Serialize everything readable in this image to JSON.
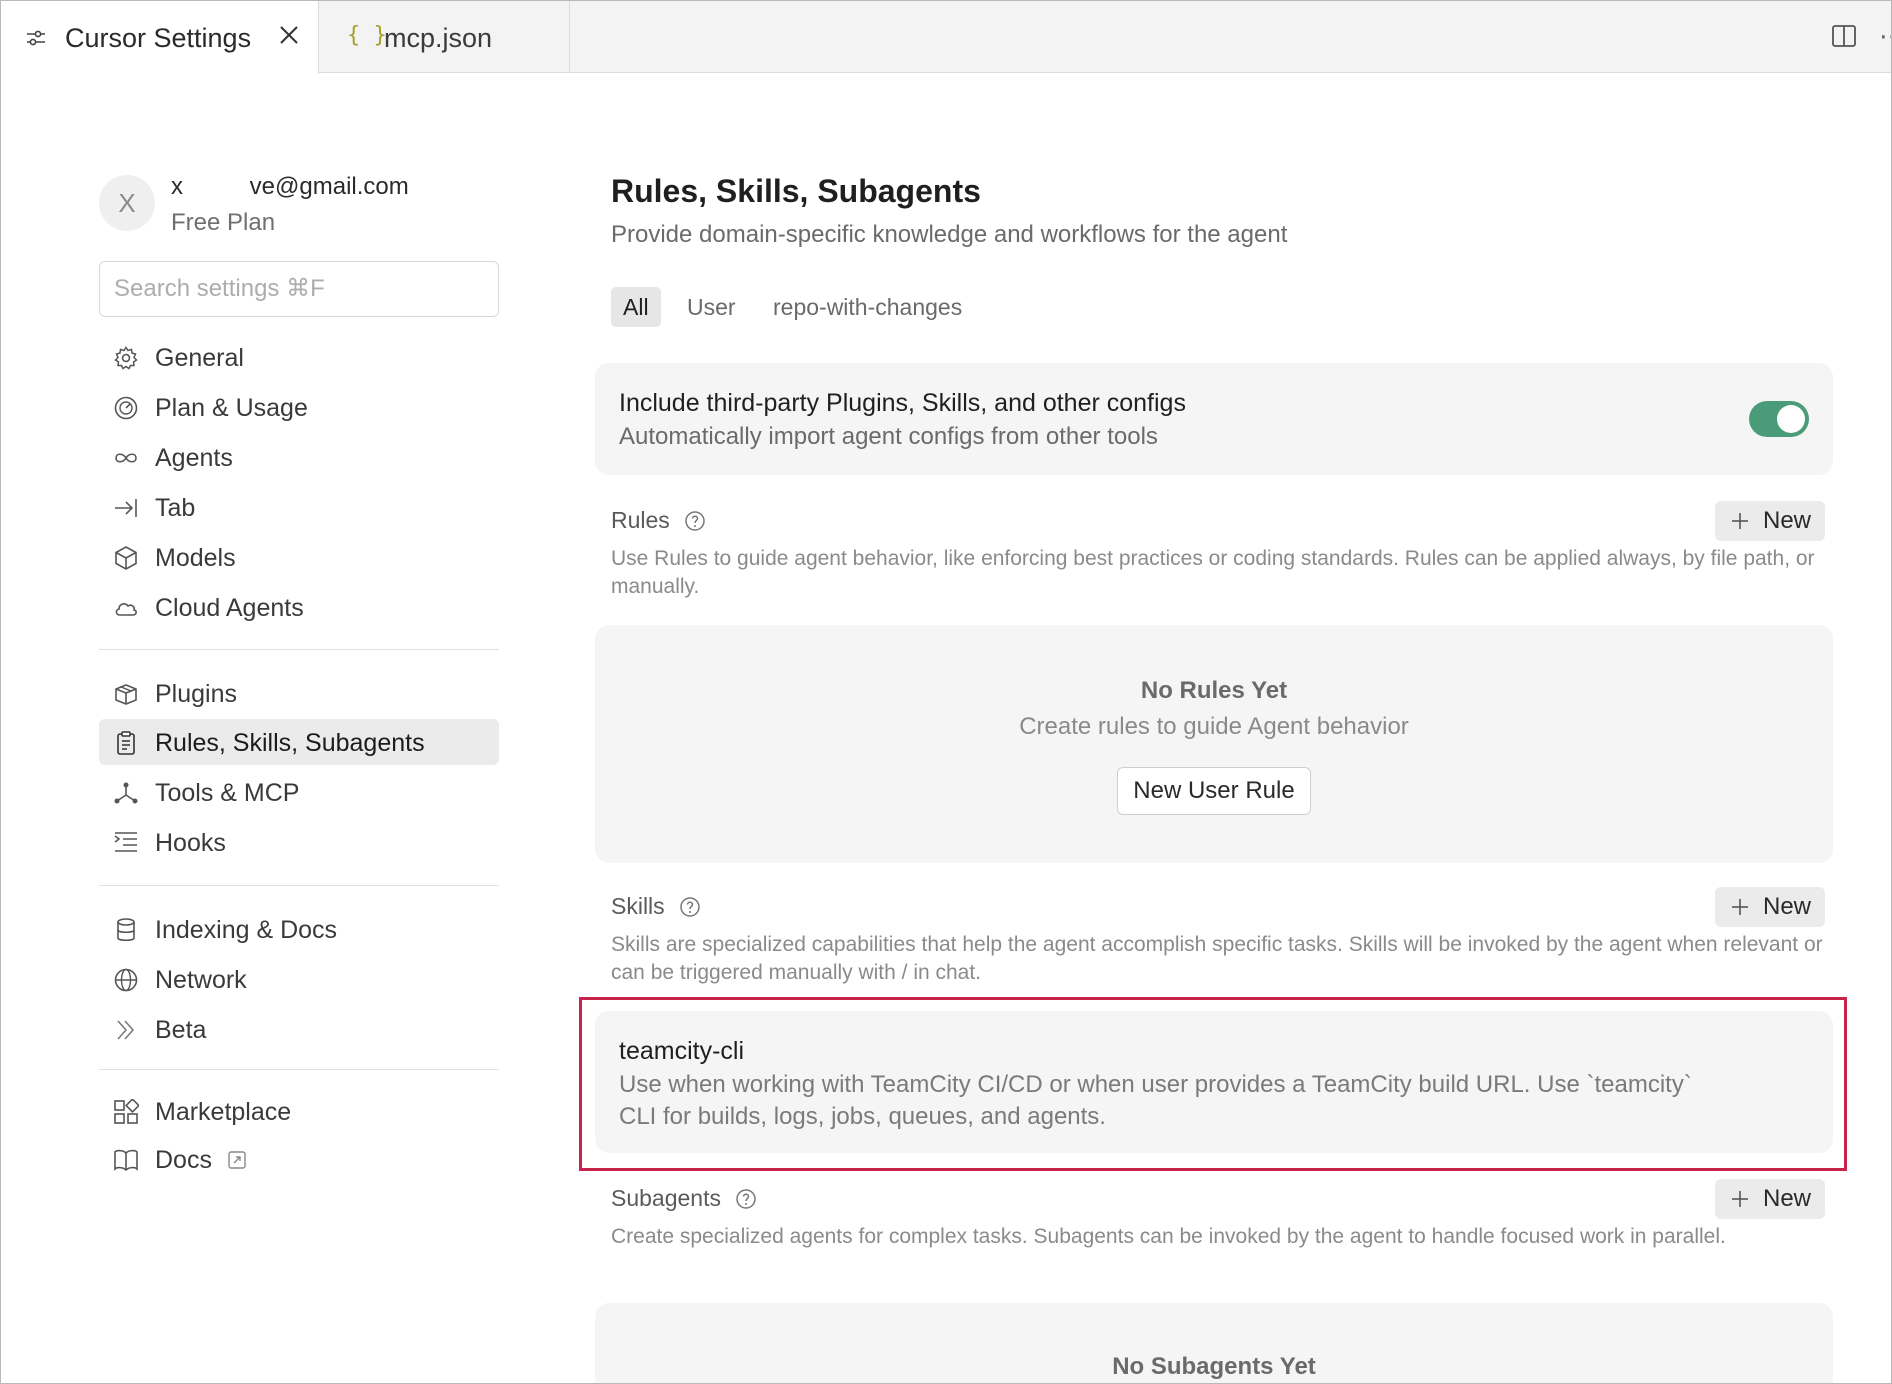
{
  "tabs": [
    {
      "label": "Cursor Settings",
      "icon": "sliders-icon",
      "active": true
    },
    {
      "label": "mcp.json",
      "icon": "json-braces-icon",
      "active": false
    }
  ],
  "tab_glyphs": {
    "braces": "{ }",
    "more": "⋯"
  },
  "account": {
    "avatar_letter": "X",
    "email": "x          ve@gmail.com",
    "plan": "Free Plan"
  },
  "search": {
    "placeholder": "Search settings ⌘F"
  },
  "nav": {
    "group1": [
      {
        "label": "General",
        "icon": "gear-icon"
      },
      {
        "label": "Plan & Usage",
        "icon": "gauge-icon"
      },
      {
        "label": "Agents",
        "icon": "infinity-icon"
      },
      {
        "label": "Tab",
        "icon": "tab-arrow-icon"
      },
      {
        "label": "Models",
        "icon": "cube-icon"
      },
      {
        "label": "Cloud Agents",
        "icon": "cloud-icon"
      }
    ],
    "group2": [
      {
        "label": "Plugins",
        "icon": "package-icon"
      },
      {
        "label": "Rules, Skills, Subagents",
        "icon": "clipboard-icon",
        "selected": true
      },
      {
        "label": "Tools & MCP",
        "icon": "nodes-icon"
      },
      {
        "label": "Hooks",
        "icon": "list-indent-icon"
      }
    ],
    "group3": [
      {
        "label": "Indexing & Docs",
        "icon": "database-icon"
      },
      {
        "label": "Network",
        "icon": "globe-icon"
      },
      {
        "label": "Beta",
        "icon": "double-chevron-icon"
      }
    ],
    "group4": [
      {
        "label": "Marketplace",
        "icon": "grid-plus-icon"
      },
      {
        "label": "Docs",
        "icon": "book-icon",
        "external": true
      }
    ]
  },
  "main": {
    "title": "Rules, Skills, Subagents",
    "subtitle": "Provide domain-specific knowledge and workflows for the agent",
    "filters": [
      "All",
      "User",
      "repo-with-changes"
    ],
    "active_filter": "All",
    "third_party": {
      "title": "Include third-party Plugins, Skills, and other configs",
      "description": "Automatically import agent configs from other tools",
      "enabled": true
    },
    "rules": {
      "title": "Rules",
      "new_label": "New",
      "description": "Use Rules to guide agent behavior, like enforcing best practices or coding standards. Rules can be applied always, by file path, or manually.",
      "empty_title": "No Rules Yet",
      "empty_subtitle": "Create rules to guide Agent behavior",
      "new_user_rule_label": "New User Rule"
    },
    "skills": {
      "title": "Skills",
      "new_label": "New",
      "description": "Skills are specialized capabilities that help the agent accomplish specific tasks. Skills will be invoked by the agent when relevant or can be triggered manually with / in chat.",
      "items": [
        {
          "name": "teamcity-cli",
          "description": "Use when working with TeamCity CI/CD or when user provides a TeamCity build URL. Use `teamcity` CLI for builds, logs, jobs, queues, and agents."
        }
      ]
    },
    "subagents": {
      "title": "Subagents",
      "new_label": "New",
      "description": "Create specialized agents for complex tasks. Subagents can be invoked by the agent to handle focused work in parallel.",
      "empty_title": "No Subagents Yet"
    }
  },
  "colors": {
    "toggle_on": "#4a9c78",
    "highlight_border": "#c8234a",
    "selected_nav_bg": "#ebebeb"
  }
}
